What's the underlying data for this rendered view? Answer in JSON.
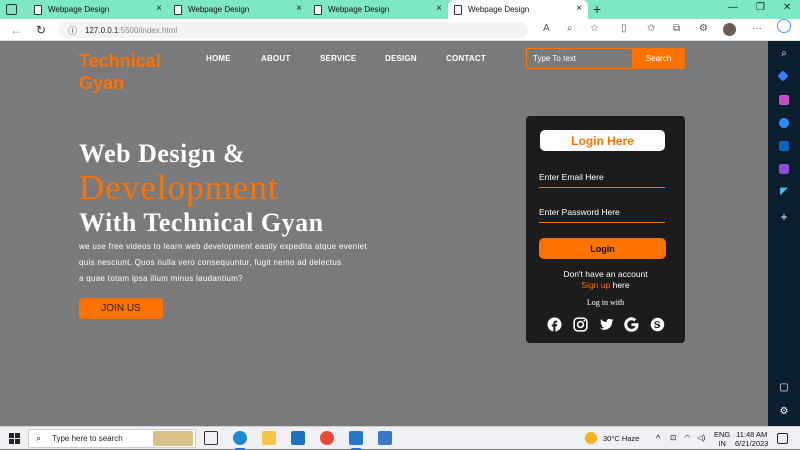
{
  "browser": {
    "tabs": [
      {
        "title": "Webpage Design",
        "active": false
      },
      {
        "title": "Webpage Design",
        "active": false
      },
      {
        "title": "Webpage Design",
        "active": false
      },
      {
        "title": "Webpage Design",
        "active": true
      }
    ],
    "address": {
      "host": "127.0.0.1",
      "path": ":5500/index.html"
    }
  },
  "site": {
    "logo_line1": "Technical",
    "logo_line2": "Gyan",
    "menu": [
      "HOME",
      "ABOUT",
      "SERVICE",
      "DESIGN",
      "CONTACT"
    ],
    "search_placeholder": "Type To text",
    "search_button": "Search"
  },
  "hero": {
    "line1": "Web Design &",
    "line2": "Development",
    "line3": "With Technical Gyan",
    "para_lines": [
      "we use free videos to learn web development easily expedita atque eveniet",
      "quis nesciunt. Quos nulla vero consequuntur, fugit nemo ad delectus",
      "a quae totam ipsa illum minus laudantium?"
    ],
    "join_button": "JOIN US"
  },
  "login": {
    "title": "Login Here",
    "email_placeholder": "Enter Email Here",
    "password_placeholder": "Enter Password Here",
    "login_button": "Login",
    "no_account": "Don't have an account",
    "signup_link": "Sign up",
    "signup_suffix": " here",
    "login_with": "Log in with",
    "socials": [
      "facebook-icon",
      "instagram-icon",
      "twitter-icon",
      "google-icon",
      "skype-icon"
    ]
  },
  "taskbar": {
    "search_placeholder": "Type here to search",
    "weather": "30°C  Haze",
    "lang_line1": "ENG",
    "lang_line2": "IN",
    "time": "11:48 AM",
    "date": "6/21/2023"
  },
  "colors": {
    "accent": "#ff7200",
    "page_bg": "#7a7a7a",
    "card_bg": "#1c1c1c"
  }
}
